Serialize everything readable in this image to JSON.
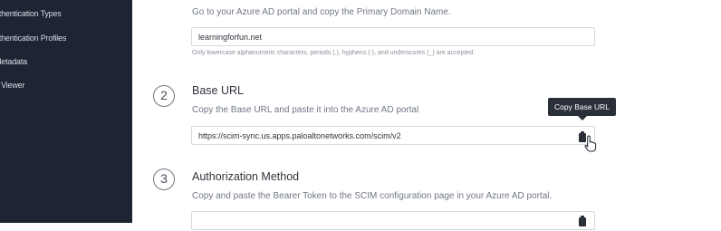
{
  "sidebar": {
    "items": [
      {
        "label": "uthentication Types"
      },
      {
        "label": "uthentication Profiles"
      },
      {
        "label": "Metadata"
      },
      {
        "label": "g Viewer"
      }
    ]
  },
  "domain_section": {
    "helper": "Go to your Azure AD portal and copy the Primary Domain Name.",
    "value": "learningforfun.net",
    "hint": "Only lowercase alphanumeric characters, periods (.), hyphens (-), and underscores (_) are accepted."
  },
  "steps": [
    {
      "number": "2",
      "title": "Base URL",
      "helper": "Copy the Base URL and paste it into the Azure AD portal",
      "value": "https://scim-sync.us.apps.paloaltonetworks.com/scim/v2"
    },
    {
      "number": "3",
      "title": "Authorization Method",
      "helper": "Copy and paste the Bearer Token to the SCIM configuration page in your Azure AD portal.",
      "value": ""
    }
  ],
  "tooltip": {
    "label": "Copy Base URL"
  },
  "icons": {
    "copy": "clipboard-icon",
    "cursor": "hand-pointer-icon"
  },
  "colors": {
    "sidebar_bg": "#1e2433",
    "tooltip_bg": "#2b2f37"
  }
}
